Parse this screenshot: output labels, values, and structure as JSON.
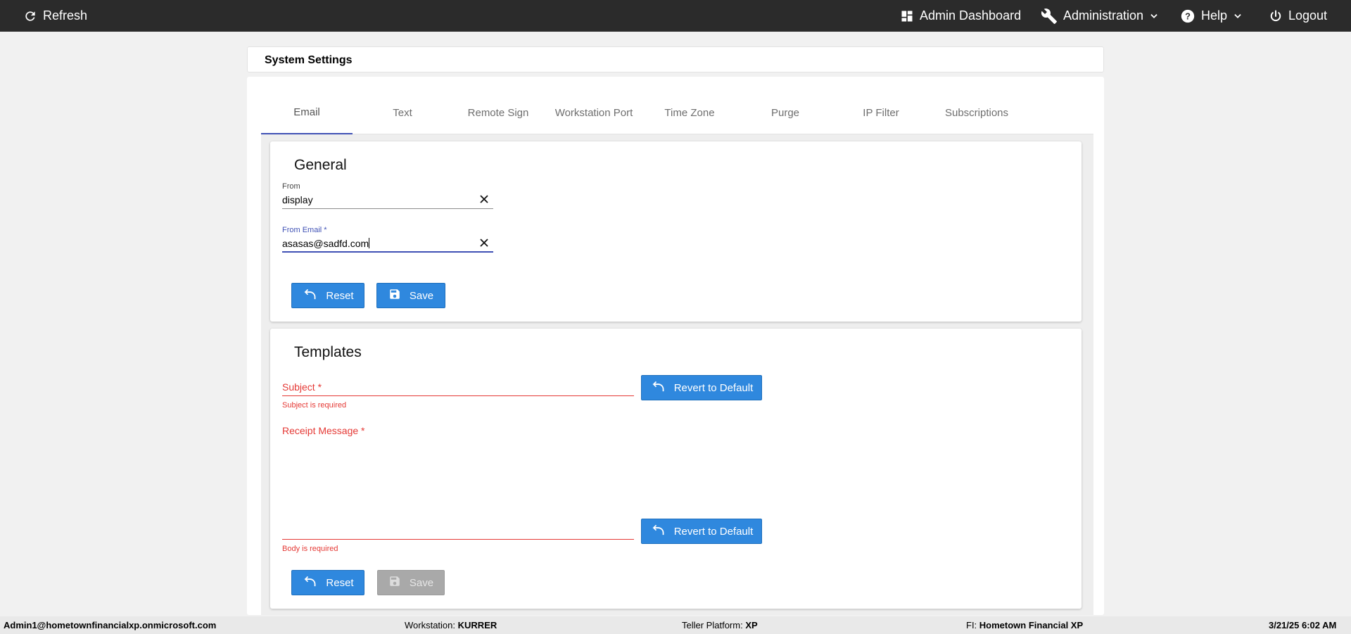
{
  "topbar": {
    "refresh_label": "Refresh",
    "admin_dashboard_label": "Admin Dashboard",
    "administration_label": "Administration",
    "help_label": "Help",
    "logout_label": "Logout",
    "background_color": "#2b2b2b"
  },
  "page": {
    "title": "System Settings"
  },
  "tabs": [
    {
      "label": "Email",
      "active": true
    },
    {
      "label": "Text",
      "active": false
    },
    {
      "label": "Remote Sign",
      "active": false
    },
    {
      "label": "Workstation Port",
      "active": false
    },
    {
      "label": "Time Zone",
      "active": false
    },
    {
      "label": "Purge",
      "active": false
    },
    {
      "label": "IP Filter",
      "active": false
    },
    {
      "label": "Subscriptions",
      "active": false
    }
  ],
  "general": {
    "title": "General",
    "from_label": "From",
    "from_value": "display",
    "from_email_label": "From Email *",
    "from_email_value": "asasas@sadfd.com",
    "reset_label": "Reset",
    "save_label": "Save"
  },
  "templates": {
    "title": "Templates",
    "subject_label": "Subject *",
    "subject_value": "",
    "subject_error": "Subject is required",
    "revert_label": "Revert to Default",
    "receipt_label": "Receipt Message *",
    "receipt_value": "",
    "body_error": "Body is required",
    "reset_label": "Reset",
    "save_label": "Save"
  },
  "statusbar": {
    "user": "Admin1@hometownfinancialxp.onmicrosoft.com",
    "workstation_label": "Workstation:",
    "workstation_value": "KURRER",
    "teller_label": "Teller Platform:",
    "teller_value": "XP",
    "fi_label": "FI:",
    "fi_value": "Hometown Financial XP",
    "datetime": "3/21/25 6:02 AM"
  },
  "colors": {
    "accent": "#3f51b5",
    "button": "#2f88de",
    "error": "#e53935"
  },
  "icons": [
    "refresh-icon",
    "dashboard-icon",
    "wrench-icon",
    "chevron-down-icon",
    "help-icon",
    "power-icon",
    "close-icon",
    "undo-icon",
    "save-icon"
  ]
}
